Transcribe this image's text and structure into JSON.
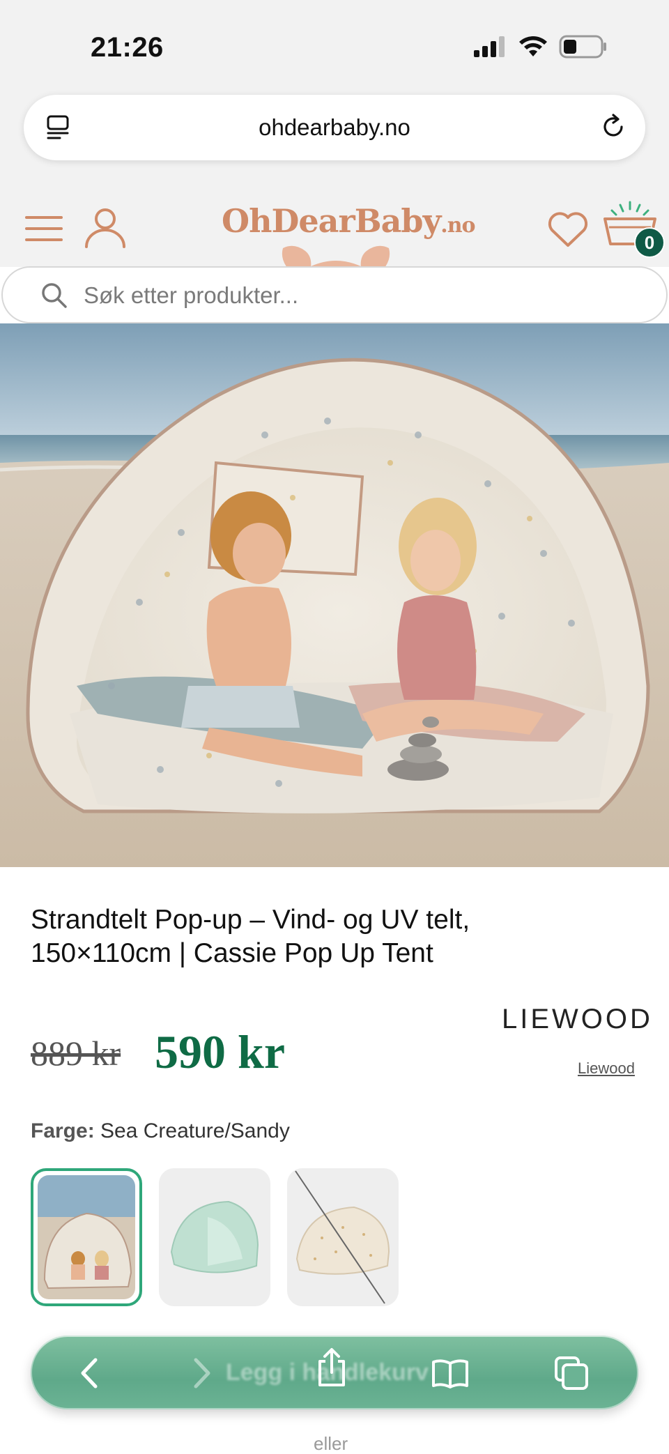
{
  "status_bar": {
    "time": "21:26"
  },
  "browser": {
    "url": "ohdearbaby.no"
  },
  "header": {
    "logo_main": "OhDearBaby",
    "logo_tld": ".no",
    "cart_count": "0"
  },
  "search": {
    "placeholder": "Søk etter produkter..."
  },
  "product": {
    "title": "Strandtelt Pop-up – Vind- og UV telt, 150×110cm | Cassie Pop Up Tent",
    "price_old": "889 kr",
    "price_new": "590 kr",
    "brand_logo": "LIEWOOD",
    "brand_link": "Liewood",
    "color_label": "Farge:",
    "color_value": "Sea Creature/Sandy",
    "swatches": [
      {
        "name": "Sea Creature/Sandy",
        "selected": true
      },
      {
        "name": "Mint",
        "selected": false
      },
      {
        "name": "Sandy",
        "sold_out": true
      }
    ]
  },
  "toolbar": {
    "behind_text": "Legg i handlekurv",
    "below_text": "eller"
  },
  "colors": {
    "brand": "#cf8a67",
    "price_green": "#0f6b45",
    "badge_green": "#0f5a46",
    "toolbar_green": "#6bb394"
  }
}
